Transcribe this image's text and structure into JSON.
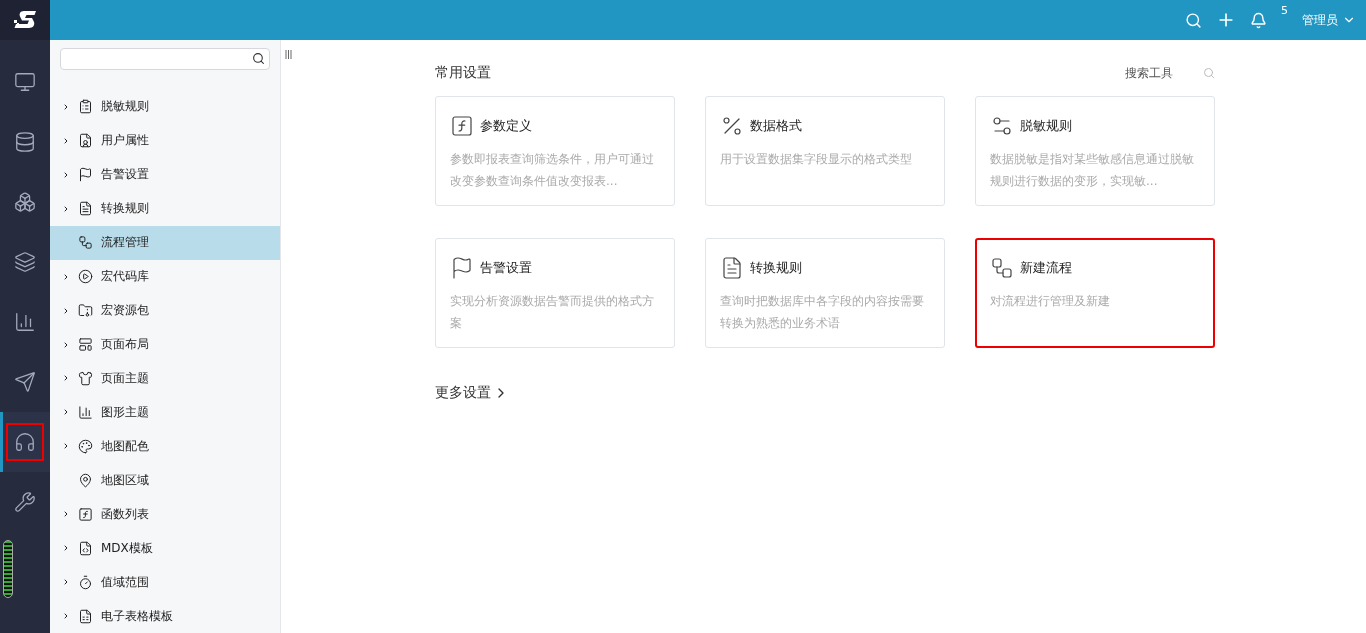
{
  "topbar": {
    "notification_count": "5",
    "user": "管理员"
  },
  "nav_rail": [
    {
      "selected": false,
      "highlighted": false
    },
    {
      "selected": false,
      "highlighted": false
    },
    {
      "selected": false,
      "highlighted": false
    },
    {
      "selected": false,
      "highlighted": false
    },
    {
      "selected": false,
      "highlighted": false
    },
    {
      "selected": false,
      "highlighted": false
    },
    {
      "selected": true,
      "highlighted": true
    },
    {
      "selected": false,
      "highlighted": false
    }
  ],
  "tree": {
    "items": [
      {
        "label": "脱敏规则",
        "expandable": true,
        "selected": false
      },
      {
        "label": "用户属性",
        "expandable": true,
        "selected": false
      },
      {
        "label": "告警设置",
        "expandable": true,
        "selected": false
      },
      {
        "label": "转换规则",
        "expandable": true,
        "selected": false
      },
      {
        "label": "流程管理",
        "expandable": false,
        "selected": true
      },
      {
        "label": "宏代码库",
        "expandable": true,
        "selected": false
      },
      {
        "label": "宏资源包",
        "expandable": true,
        "selected": false
      },
      {
        "label": "页面布局",
        "expandable": true,
        "selected": false
      },
      {
        "label": "页面主题",
        "expandable": true,
        "selected": false
      },
      {
        "label": "图形主题",
        "expandable": true,
        "selected": false
      },
      {
        "label": "地图配色",
        "expandable": true,
        "selected": false
      },
      {
        "label": "地图区域",
        "expandable": false,
        "selected": false
      },
      {
        "label": "函数列表",
        "expandable": true,
        "selected": false
      },
      {
        "label": "MDX模板",
        "expandable": true,
        "selected": false
      },
      {
        "label": "值域范围",
        "expandable": true,
        "selected": false
      },
      {
        "label": "电子表格模板",
        "expandable": true,
        "selected": false
      }
    ]
  },
  "main": {
    "section_title": "常用设置",
    "search_tool": "搜索工具",
    "cards": [
      {
        "title": "参数定义",
        "description": "参数即报表查询筛选条件，用户可通过改变参数查询条件值改变报表...",
        "highlighted": false
      },
      {
        "title": "数据格式",
        "description": "用于设置数据集字段显示的格式类型",
        "highlighted": false
      },
      {
        "title": "脱敏规则",
        "description": "数据脱敏是指对某些敏感信息通过脱敏规则进行数据的变形，实现敏...",
        "highlighted": false
      },
      {
        "title": "告警设置",
        "description": "实现分析资源数据告警而提供的格式方案",
        "highlighted": false
      },
      {
        "title": "转换规则",
        "description": "查询时把数据库中各字段的内容按需要转换为熟悉的业务术语",
        "highlighted": false
      },
      {
        "title": "新建流程",
        "description": "对流程进行管理及新建",
        "highlighted": true
      }
    ],
    "more": "更多设置"
  }
}
